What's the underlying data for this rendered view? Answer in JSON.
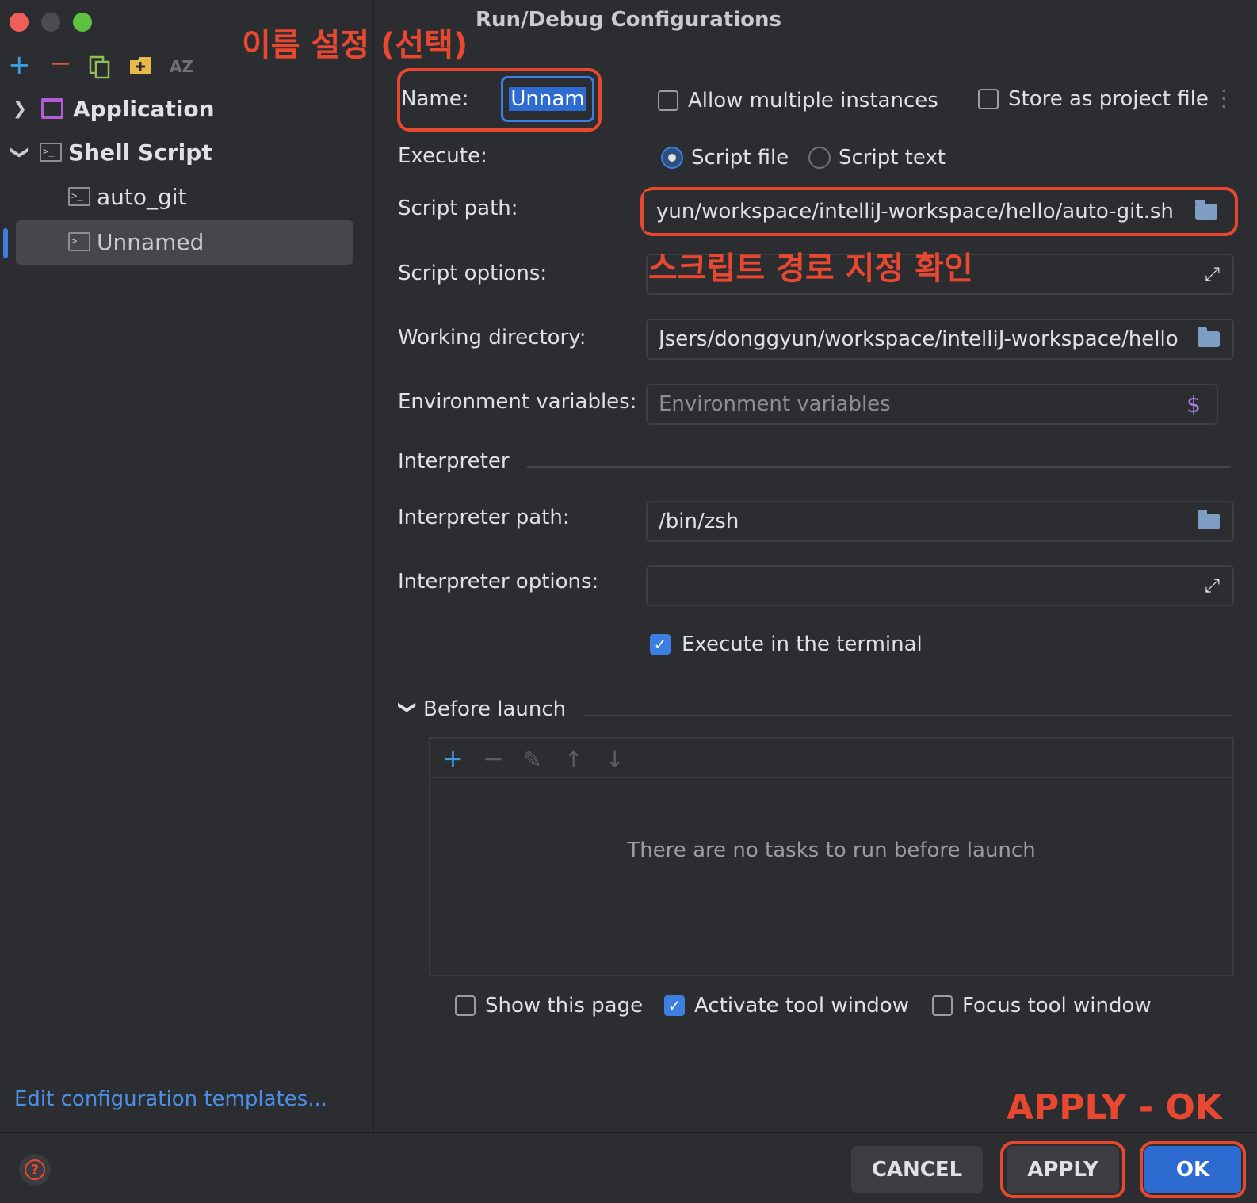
{
  "window": {
    "title": "Run/Debug Configurations"
  },
  "colors": {
    "accent": "#3d7fe0",
    "annotation": "#e8482f",
    "link": "#4c8fe6"
  },
  "toolbar": {
    "icons": [
      "plus-icon",
      "minus-icon",
      "copy-icon",
      "folder-add-icon",
      "sort-az-icon"
    ],
    "sort_label": "AZ"
  },
  "tree": {
    "application": "Application",
    "shell_script": "Shell Script",
    "auto_git": "auto_git",
    "unnamed": "Unnamed"
  },
  "left_footer": {
    "templates_link": "Edit configuration templates..."
  },
  "form": {
    "name_label": "Name:",
    "name_value": "Unnam",
    "allow_multiple": "Allow multiple instances",
    "store_project": "Store as project file",
    "execute_label": "Execute:",
    "script_file": "Script file",
    "script_text": "Script text",
    "script_path_label": "Script path:",
    "script_path_value": "yun/workspace/intelliJ-workspace/hello/auto-git.sh",
    "script_options_label": "Script options:",
    "working_dir_label": "Working directory:",
    "working_dir_value": "Jsers/donggyun/workspace/intelliJ-workspace/hello",
    "env_label": "Environment variables:",
    "env_placeholder": "Environment variables",
    "env_symbol": "$",
    "interpreter_section": "Interpreter",
    "interpreter_path_label": "Interpreter path:",
    "interpreter_path_value": "/bin/zsh",
    "interpreter_options_label": "Interpreter options:",
    "execute_terminal": "Execute in the terminal",
    "before_launch": "Before launch",
    "no_tasks": "There are no tasks to run before launch",
    "show_page": "Show this page",
    "activate_tool": "Activate tool window",
    "focus_tool": "Focus tool window"
  },
  "buttons": {
    "cancel": "CANCEL",
    "apply": "APPLY",
    "ok": "OK",
    "help": "?"
  },
  "annotations": {
    "name_note": "이름 설정 (선택)",
    "path_note": "스크립트 경로 지정 확인",
    "apply_note": "APPLY - OK"
  }
}
